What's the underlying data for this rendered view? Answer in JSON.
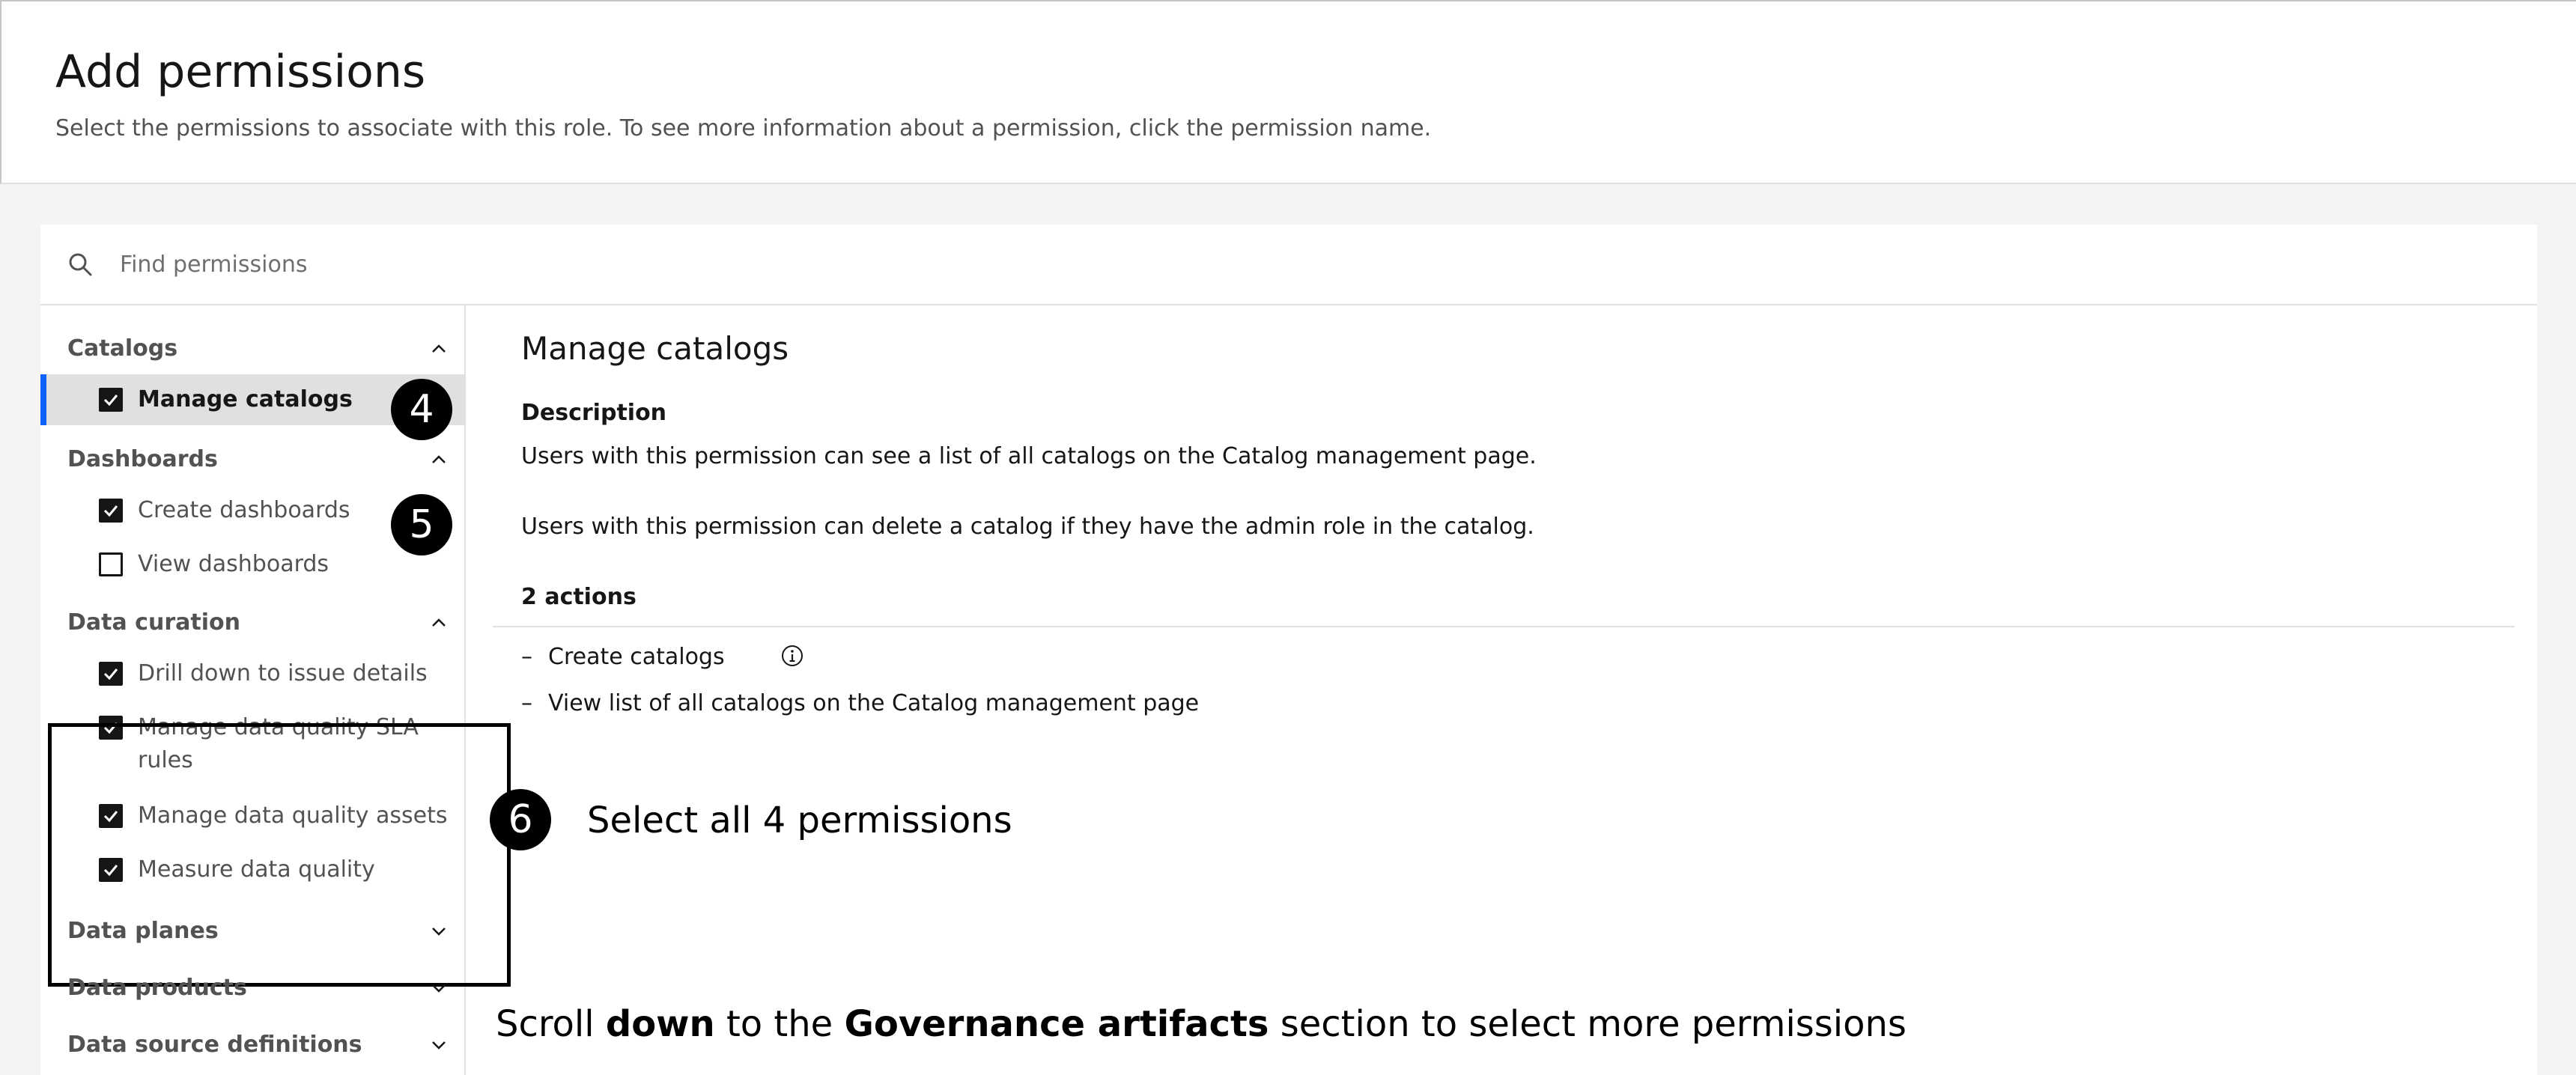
{
  "header": {
    "title": "Add permissions",
    "subtitle": "Select the permissions to associate with this role. To see more information about a permission, click the permission name."
  },
  "search": {
    "placeholder": "Find permissions",
    "icon": "search-icon"
  },
  "sidebar": {
    "categories": [
      {
        "label": "Catalogs",
        "expanded": true
      },
      {
        "label": "Dashboards",
        "expanded": true
      },
      {
        "label": "Data curation",
        "expanded": true
      },
      {
        "label": "Data planes",
        "expanded": false
      },
      {
        "label": "Data products",
        "expanded": false
      },
      {
        "label": "Data source definitions",
        "expanded": false
      }
    ],
    "items": [
      {
        "label": "Manage catalogs",
        "checked": true,
        "selected": true
      },
      {
        "label": "Create dashboards",
        "checked": true
      },
      {
        "label": "View dashboards",
        "checked": false
      },
      {
        "label": "Drill down to issue details",
        "checked": true
      },
      {
        "label_line1": "Manage data quality SLA",
        "label_line2": "rules",
        "checked": true
      },
      {
        "label": "Manage data quality assets",
        "checked": true
      },
      {
        "label": "Measure data quality",
        "checked": true
      }
    ]
  },
  "detail": {
    "title": "Manage catalogs",
    "description_heading": "Description",
    "description_lines": [
      "Users with this permission can see a list of all catalogs on the Catalog management page.",
      "Users with this permission can delete a catalog if they have the admin role in the catalog."
    ],
    "actions_heading": "2 actions",
    "actions": [
      {
        "dash": "–",
        "label": "Create catalogs",
        "info_icon": "info-icon"
      },
      {
        "dash": "–",
        "label": "View list of all catalogs on the Catalog management page"
      }
    ]
  },
  "annotations": {
    "badge4": "4",
    "badge5": "5",
    "badge6": "6",
    "select_all": "Select all 4 permissions",
    "scroll_part1": "Scroll ",
    "scroll_bold1": "down",
    "scroll_part2": " to the ",
    "scroll_bold2": "Governance artifacts",
    "scroll_part3": " section to select more permissions"
  },
  "colors": {
    "accent_blue": "#0f62fe",
    "selected_bg": "#e0e0e0",
    "page_bg": "#f4f4f4"
  }
}
